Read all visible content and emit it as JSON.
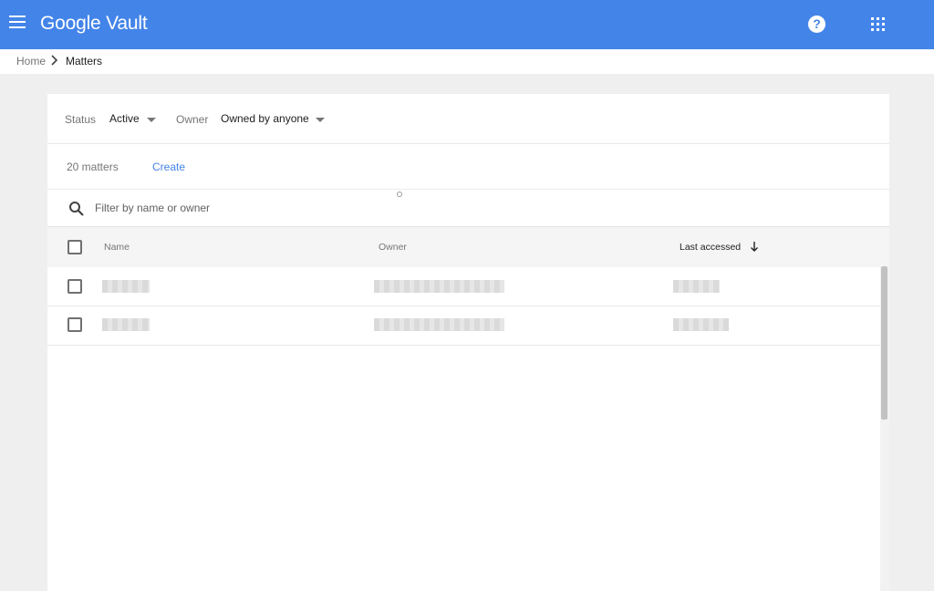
{
  "header": {
    "app_title": "Google Vault",
    "menu_icon": "hamburger-menu-icon",
    "help_icon": "help-circle-icon",
    "apps_icon": "apps-grid-icon",
    "bar_color": "#4384e9"
  },
  "breadcrumb": {
    "home": "Home",
    "current": "Matters",
    "separator_icon": "chevron-right-icon"
  },
  "filters": {
    "status_label": "Status",
    "status_value": "Active",
    "owner_label": "Owner",
    "owner_value": "Owned by anyone"
  },
  "summary": {
    "count_text": "20 matters",
    "create_label": "Create"
  },
  "search": {
    "placeholder": "Filter by name or owner",
    "value": ""
  },
  "table": {
    "columns": {
      "name": "Name",
      "owner": "Owner",
      "last_accessed": "Last accessed"
    },
    "sort": {
      "column": "Last accessed",
      "direction": "descending"
    },
    "rows": [
      {
        "name": "[redacted]",
        "owner": "[redacted]",
        "last_accessed": "[redacted]"
      },
      {
        "name": "[redacted]",
        "owner": "[redacted]",
        "last_accessed": "[redacted]"
      }
    ]
  }
}
